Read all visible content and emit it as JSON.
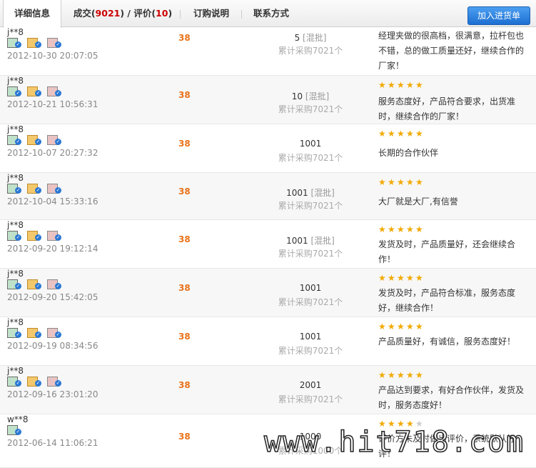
{
  "tabs": [
    {
      "label": "详细信息"
    },
    {
      "label_prefix": "成交(",
      "deals": "9021",
      "mid": ") / 评价(",
      "reviews": "10",
      "suffix": ")"
    },
    {
      "label": "订购说明"
    },
    {
      "label": "联系方式"
    }
  ],
  "add_to_cart": "加入进货单",
  "watermark": "www.hit718.com",
  "records": [
    {
      "buyer": "j**8",
      "date": "2012-10-30 20:07:05",
      "price": "38",
      "qty": "5",
      "mixed": "[混批]",
      "total": "累计采购7021个",
      "stars": 0,
      "comment": "经理夹做的很高档，很满意，拉杆包也不错，总的做工质量还好，继续合作的厂家！"
    },
    {
      "buyer": "j**8",
      "date": "2012-10-21 10:56:31",
      "price": "38",
      "qty": "10",
      "mixed": "[混批]",
      "total": "累计采购7021个",
      "stars": 5,
      "comment": "服务态度好，产品符合要求，出货准时，继续合作的厂家！"
    },
    {
      "buyer": "j**8",
      "date": "2012-10-07 20:27:32",
      "price": "38",
      "qty": "1001",
      "mixed": "",
      "total": "累计采购7021个",
      "stars": 5,
      "comment": "长期的合作伙伴"
    },
    {
      "buyer": "j**8",
      "date": "2012-10-04 15:33:16",
      "price": "38",
      "qty": "1001",
      "mixed": "[混批]",
      "total": "累计采购7021个",
      "stars": 5,
      "comment": "大厂就是大厂,有信誉"
    },
    {
      "buyer": "j**8",
      "date": "2012-09-20 19:12:14",
      "price": "38",
      "qty": "1001",
      "mixed": "[混批]",
      "total": "累计采购7021个",
      "stars": 5,
      "comment": "发货及时，产品质量好，还会继续合作！"
    },
    {
      "buyer": "j**8",
      "date": "2012-09-20 15:42:05",
      "price": "38",
      "qty": "1001",
      "mixed": "",
      "total": "累计采购7021个",
      "stars": 5,
      "comment": "发货及时，产品符合标准，服务态度好，继续合作！"
    },
    {
      "buyer": "j**8",
      "date": "2012-09-19 08:34:56",
      "price": "38",
      "qty": "1001",
      "mixed": "",
      "total": "累计采购7021个",
      "stars": 5,
      "comment": "产品质量好，有诚信，服务态度好！"
    },
    {
      "buyer": "j**8",
      "date": "2012-09-16 23:01:20",
      "price": "38",
      "qty": "2001",
      "mixed": "",
      "total": "累计采购7021个",
      "stars": 5,
      "comment": "产品达到要求，有好合作伙伴，发货及时，服务态度好！"
    },
    {
      "buyer": "w**8",
      "date": "2012-06-14 11:06:21",
      "price": "38",
      "qty": "1000",
      "mixed": "",
      "total": "累计采购1000个",
      "stars": 4,
      "comment": "评价方未及时做出评价，系统默认好评！"
    }
  ],
  "colors": {
    "price": "#e8731a",
    "tab_count": "#cc0000",
    "star": "#f2a900",
    "button": "#1c6fd1"
  }
}
